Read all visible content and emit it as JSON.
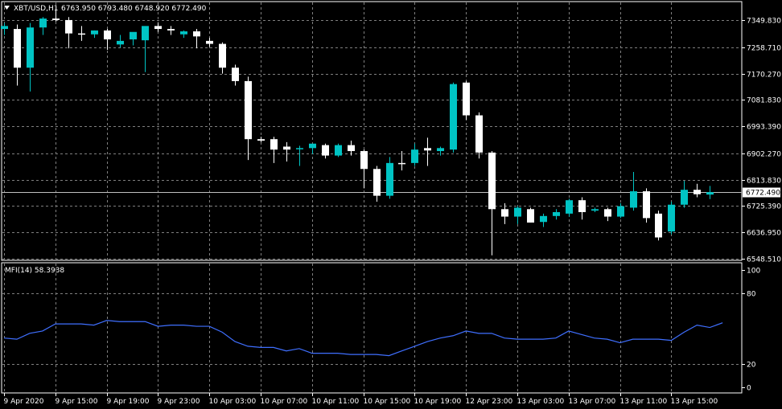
{
  "header": {
    "symbol": "XBT/USD,H1",
    "ohlc": "6763.950 6793.480 6748.920 6772.490",
    "indicator": "MFI(14) 58.3938"
  },
  "colors": {
    "background": "#000000",
    "grid": "#7f7f7f",
    "bull": "#00c4c4",
    "bear": "#ffffff",
    "mfi_line": "#3f6fff",
    "axis_text": "#ffffff",
    "price_line": "#c0c0c0"
  },
  "chart_data": [
    {
      "type": "candlestick",
      "title": "XBT/USD,H1",
      "price_axis_ticks": [
        "7349.830",
        "7258.710",
        "7170.270",
        "7081.830",
        "6993.390",
        "6902.270",
        "6813.830",
        "6725.390",
        "6636.950",
        "6548.510"
      ],
      "current_price": "6772.490",
      "ylim": [
        6545,
        7395
      ],
      "candles": [
        {
          "o": 7320,
          "h": 7340,
          "l": 7300,
          "c": 7330
        },
        {
          "o": 7320,
          "h": 7335,
          "l": 7130,
          "c": 7190
        },
        {
          "o": 7190,
          "h": 7340,
          "l": 7110,
          "c": 7325
        },
        {
          "o": 7325,
          "h": 7360,
          "l": 7300,
          "c": 7355
        },
        {
          "o": 7355,
          "h": 7385,
          "l": 7345,
          "c": 7350
        },
        {
          "o": 7350,
          "h": 7360,
          "l": 7255,
          "c": 7305
        },
        {
          "o": 7305,
          "h": 7330,
          "l": 7280,
          "c": 7302
        },
        {
          "o": 7302,
          "h": 7315,
          "l": 7290,
          "c": 7315
        },
        {
          "o": 7315,
          "h": 7320,
          "l": 7250,
          "c": 7285
        },
        {
          "o": 7268,
          "h": 7300,
          "l": 7258,
          "c": 7280
        },
        {
          "o": 7285,
          "h": 7305,
          "l": 7265,
          "c": 7310
        },
        {
          "o": 7282,
          "h": 7320,
          "l": 7175,
          "c": 7330
        },
        {
          "o": 7330,
          "h": 7340,
          "l": 7310,
          "c": 7320
        },
        {
          "o": 7320,
          "h": 7330,
          "l": 7300,
          "c": 7315
        },
        {
          "o": 7302,
          "h": 7315,
          "l": 7290,
          "c": 7312
        },
        {
          "o": 7312,
          "h": 7320,
          "l": 7255,
          "c": 7295
        },
        {
          "o": 7280,
          "h": 7290,
          "l": 7260,
          "c": 7270
        },
        {
          "o": 7270,
          "h": 7275,
          "l": 7170,
          "c": 7190
        },
        {
          "o": 7190,
          "h": 7200,
          "l": 7130,
          "c": 7145
        },
        {
          "o": 7145,
          "h": 7160,
          "l": 6880,
          "c": 6950
        },
        {
          "o": 6950,
          "h": 6958,
          "l": 6940,
          "c": 6945
        },
        {
          "o": 6950,
          "h": 6958,
          "l": 6870,
          "c": 6915
        },
        {
          "o": 6925,
          "h": 6940,
          "l": 6875,
          "c": 6915
        },
        {
          "o": 6918,
          "h": 6928,
          "l": 6860,
          "c": 6920
        },
        {
          "o": 6920,
          "h": 6935,
          "l": 6900,
          "c": 6935
        },
        {
          "o": 6930,
          "h": 6935,
          "l": 6885,
          "c": 6895
        },
        {
          "o": 6895,
          "h": 6935,
          "l": 6890,
          "c": 6930
        },
        {
          "o": 6930,
          "h": 6945,
          "l": 6895,
          "c": 6910
        },
        {
          "o": 6910,
          "h": 6915,
          "l": 6785,
          "c": 6850
        },
        {
          "o": 6850,
          "h": 6860,
          "l": 6740,
          "c": 6760
        },
        {
          "o": 6760,
          "h": 6890,
          "l": 6750,
          "c": 6870
        },
        {
          "o": 6870,
          "h": 6910,
          "l": 6845,
          "c": 6868
        },
        {
          "o": 6870,
          "h": 6935,
          "l": 6860,
          "c": 6915
        },
        {
          "o": 6920,
          "h": 6955,
          "l": 6860,
          "c": 6912
        },
        {
          "o": 6910,
          "h": 6925,
          "l": 6895,
          "c": 6920
        },
        {
          "o": 6915,
          "h": 7140,
          "l": 6905,
          "c": 7135
        },
        {
          "o": 7140,
          "h": 7145,
          "l": 7015,
          "c": 7030
        },
        {
          "o": 7030,
          "h": 7040,
          "l": 6885,
          "c": 6905
        },
        {
          "o": 6905,
          "h": 6910,
          "l": 6560,
          "c": 6715
        },
        {
          "o": 6715,
          "h": 6735,
          "l": 6665,
          "c": 6690
        },
        {
          "o": 6690,
          "h": 6725,
          "l": 6665,
          "c": 6720
        },
        {
          "o": 6715,
          "h": 6720,
          "l": 6670,
          "c": 6670
        },
        {
          "o": 6672,
          "h": 6700,
          "l": 6655,
          "c": 6692
        },
        {
          "o": 6692,
          "h": 6715,
          "l": 6680,
          "c": 6705
        },
        {
          "o": 6700,
          "h": 6750,
          "l": 6690,
          "c": 6745
        },
        {
          "o": 6745,
          "h": 6755,
          "l": 6680,
          "c": 6705
        },
        {
          "o": 6710,
          "h": 6720,
          "l": 6705,
          "c": 6715
        },
        {
          "o": 6715,
          "h": 6720,
          "l": 6675,
          "c": 6690
        },
        {
          "o": 6690,
          "h": 6735,
          "l": 6685,
          "c": 6725
        },
        {
          "o": 6720,
          "h": 6840,
          "l": 6710,
          "c": 6775
        },
        {
          "o": 6775,
          "h": 6785,
          "l": 6670,
          "c": 6685
        },
        {
          "o": 6700,
          "h": 6710,
          "l": 6610,
          "c": 6620
        },
        {
          "o": 6640,
          "h": 6740,
          "l": 6630,
          "c": 6730
        },
        {
          "o": 6730,
          "h": 6810,
          "l": 6720,
          "c": 6780
        },
        {
          "o": 6780,
          "h": 6800,
          "l": 6755,
          "c": 6765
        },
        {
          "o": 6764,
          "h": 6793,
          "l": 6749,
          "c": 6772
        }
      ]
    },
    {
      "type": "line",
      "title": "MFI(14) 58.3938",
      "ticks": [
        "100",
        "80",
        "20",
        "0"
      ],
      "ylim": [
        0,
        100
      ],
      "series": [
        {
          "values": [
            42,
            41,
            46,
            48,
            54,
            54,
            54,
            53,
            57,
            56,
            56,
            56,
            52,
            53,
            53,
            52,
            52,
            47,
            39,
            35,
            34,
            34,
            31,
            33,
            29,
            29,
            29,
            28,
            28,
            28,
            27,
            31,
            35,
            39,
            42,
            44,
            48,
            46,
            46,
            42,
            41,
            41,
            41,
            42,
            48,
            45,
            42,
            41,
            38,
            41,
            41,
            41,
            40,
            47,
            53,
            51,
            55
          ]
        }
      ]
    }
  ],
  "x_axis_labels": [
    "9 Apr 2020",
    "9 Apr 15:00",
    "9 Apr 19:00",
    "9 Apr 23:00",
    "10 Apr 03:00",
    "10 Apr 07:00",
    "10 Apr 11:00",
    "10 Apr 15:00",
    "10 Apr 19:00",
    "12 Apr 23:00",
    "13 Apr 03:00",
    "13 Apr 07:00",
    "13 Apr 11:00",
    "13 Apr 15:00"
  ]
}
